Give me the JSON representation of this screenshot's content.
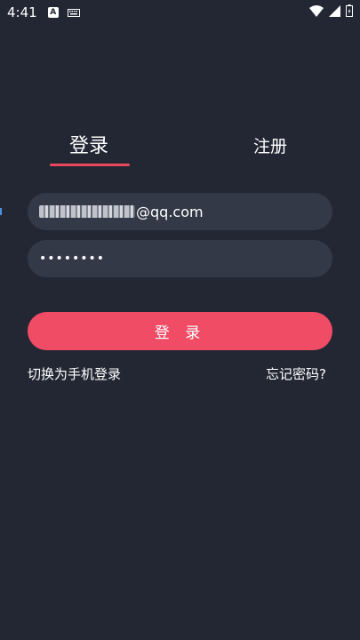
{
  "status_bar": {
    "time": "4:41",
    "a_icon_letter": "A"
  },
  "tabs": {
    "login": "登录",
    "register": "注册"
  },
  "account": {
    "value_suffix": "@qq.com"
  },
  "password": {
    "masked_value": "••••••••"
  },
  "login_button": {
    "label": "登 录"
  },
  "links": {
    "switch_to_phone": "切换为手机登录",
    "forgot_password": "忘记密码?"
  },
  "colors": {
    "background": "#232734",
    "field": "#343947",
    "accent": "#f14c66"
  }
}
